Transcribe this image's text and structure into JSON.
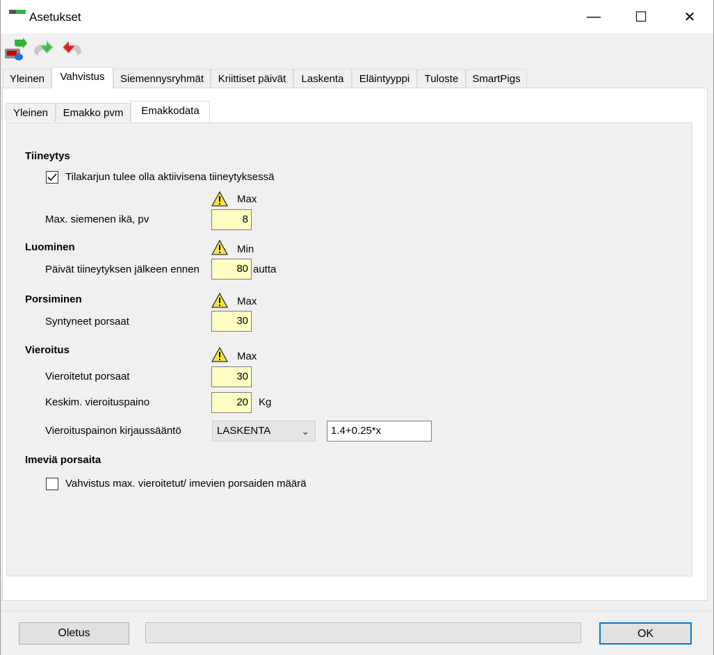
{
  "window": {
    "title": "Asetukset"
  },
  "titlebar_buttons": {
    "minimize": "—",
    "maximize": "☐",
    "close": "✕"
  },
  "main_tabs": [
    "Yleinen",
    "Vahvistus",
    "Siemennysryhmät",
    "Kriittiset päivät",
    "Laskenta",
    "Eläintyyppi",
    "Tuloste",
    "SmartPigs"
  ],
  "sub_tabs": [
    "Yleinen",
    "Emakko pvm",
    "Emakkodata"
  ],
  "form": {
    "tiineytys": {
      "heading": "Tiineytys",
      "checkbox_label": "Tilakarjun tulee olla aktiivisena tiineytyksessä",
      "checkbox_checked": true,
      "limit_label": "Max",
      "field_label": "Max. siemenen ikä, pv",
      "field_value": "8"
    },
    "luominen": {
      "heading": "Luominen",
      "limit_label": "Min",
      "field_label_left": "Päivät tiineytyksen jälkeen ennen",
      "field_value": "80",
      "field_label_right": "autta"
    },
    "porsiminen": {
      "heading": "Porsiminen",
      "limit_label": "Max",
      "field_label": "Syntyneet porsaat",
      "field_value": "30"
    },
    "vieroitus": {
      "heading": "Vieroitus",
      "limit_label": "Max",
      "field1_label": "Vieroitetut porsaat",
      "field1_value": "30",
      "field2_label": "Keskim. vieroituspaino",
      "field2_value": "20",
      "field2_unit": "Kg",
      "rule_label": "Vieroituspainon kirjaussääntö",
      "rule_select": "LASKENTA",
      "rule_formula": "1.4+0.25*x"
    },
    "imevia": {
      "heading": "Imeviä porsaita",
      "checkbox_label": "Vahvistus max. vieroitetut/ imevien porsaiden määrä",
      "checkbox_checked": false
    }
  },
  "footer": {
    "default_button": "Oletus",
    "ok_button": "OK"
  }
}
